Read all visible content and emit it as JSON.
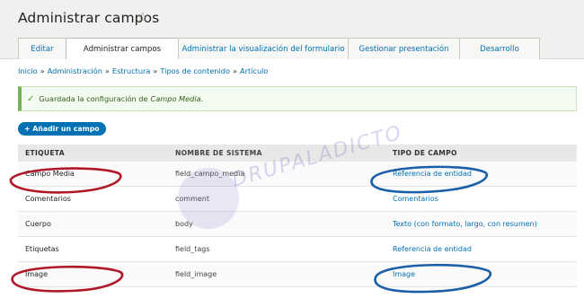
{
  "header": {
    "title": "Administrar campos",
    "tabs": [
      {
        "label": "Editar"
      },
      {
        "label": "Administrar campos"
      },
      {
        "label": "Administrar la visualización del formulario"
      },
      {
        "label": "Gestionar presentación"
      },
      {
        "label": "Desarrollo"
      }
    ]
  },
  "breadcrumb": [
    "Inicio",
    "Administración",
    "Estructura",
    "Tipos de contenido",
    "Artículo"
  ],
  "status": {
    "prefix": "Guardada la configuración de",
    "field": "Campo Media",
    "suffix": "."
  },
  "add_button": "+ Añadir un campo",
  "table": {
    "headers": [
      "ETIQUETA",
      "NOMBRE DE SISTEMA",
      "TIPO DE CAMPO"
    ],
    "rows": [
      {
        "label": "Campo Media",
        "machine": "field_campo_media",
        "type": "Referencia de entidad"
      },
      {
        "label": "Comentarios",
        "machine": "comment",
        "type": "Comentarios"
      },
      {
        "label": "Cuerpo",
        "machine": "body",
        "type": "Texto (con formato, largo, con resumen)"
      },
      {
        "label": "Etiquetas",
        "machine": "field_tags",
        "type": "Referencia de entidad"
      },
      {
        "label": "Image",
        "machine": "field_image",
        "type": "Image"
      }
    ]
  },
  "watermark": "DRUPALADICTO",
  "colors": {
    "accent": "#0071b3",
    "success_bg": "#f3faef",
    "highlight_red": "#b0182a",
    "highlight_blue": "#1a5fa8"
  }
}
